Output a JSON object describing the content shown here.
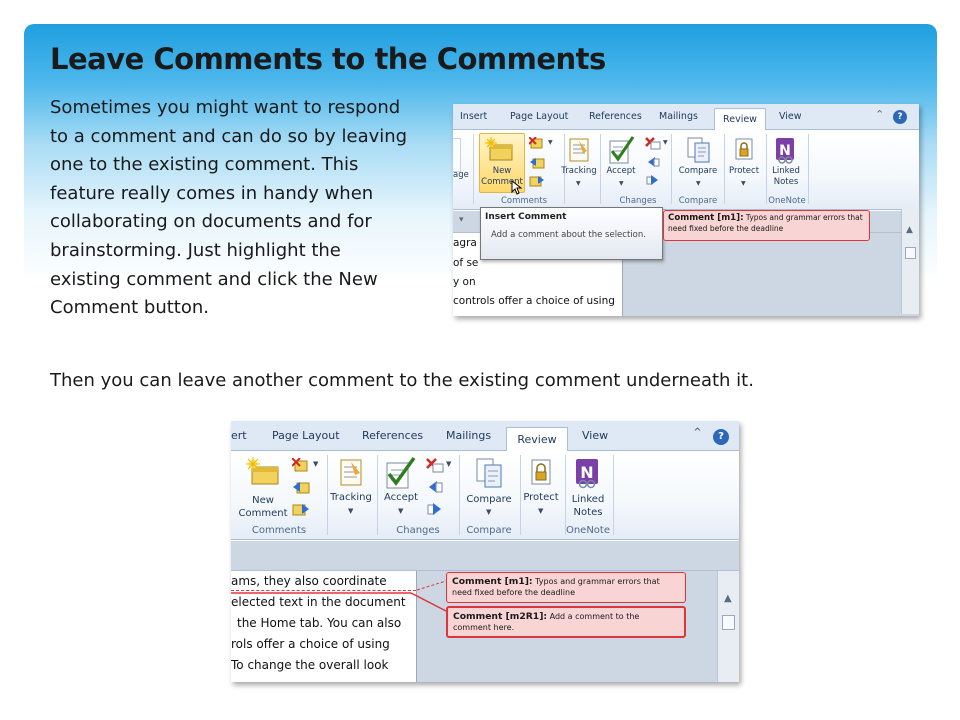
{
  "slide": {
    "title": "Leave Comments to the Comments",
    "paragraph1": "Sometimes you might want to respond to a comment and can do so by leaving one to the existing comment. This feature really comes in handy when collaborating on documents and for brainstorming. Just highlight the existing comment and click the New Comment button.",
    "paragraph2": "Then you can leave another comment to the existing comment underneath it."
  },
  "screenshot1": {
    "tabs": [
      "Insert",
      "Page Layout",
      "References",
      "Mailings",
      "Review",
      "View"
    ],
    "active_tab": "Review",
    "partial_button": "age",
    "buttons": {
      "new_comment_line1": "New",
      "new_comment_line2": "Comment",
      "tracking": "Tracking",
      "accept": "Accept",
      "compare": "Compare",
      "protect": "Protect",
      "linked_notes_line1": "Linked",
      "linked_notes_line2": "Notes"
    },
    "groups": [
      "Comments",
      "Changes",
      "Compare",
      "OneNote"
    ],
    "doc_lines": [
      "agra",
      "of se",
      "y on",
      "controls offer a choice of using"
    ],
    "tooltip_title": "Insert Comment",
    "tooltip_body": "Add a comment about the selection.",
    "comment_label": "Comment [m1]:",
    "comment_text": "Typos and grammar errors that need fixed before the deadline"
  },
  "screenshot2": {
    "tabs": [
      "ert",
      "Page Layout",
      "References",
      "Mailings",
      "Review",
      "View"
    ],
    "active_tab": "Review",
    "buttons": {
      "new_comment_line1": "New",
      "new_comment_line2": "Comment",
      "tracking": "Tracking",
      "accept": "Accept",
      "compare": "Compare",
      "protect": "Protect",
      "linked_notes_line1": "Linked",
      "linked_notes_line2": "Notes"
    },
    "groups": [
      "Comments",
      "Changes",
      "Compare",
      "OneNote"
    ],
    "doc_lines": [
      "ams, they also coordinate",
      "elected text in the document",
      "the Home tab. You can also",
      "rols offer a choice of using",
      "To change the overall look"
    ],
    "comment1_label": "Comment [m1]:",
    "comment1_text": "Typos and grammar errors that need fixed before the deadline",
    "comment2_label": "Comment [m2R1]:",
    "comment2_text": "Add a comment to the comment here."
  },
  "colors": {
    "slide_blue": "#1f9fe0",
    "comment_border": "#e0343c",
    "comment_fill": "#f9d4d4",
    "ribbon_text": "#1e395b"
  }
}
